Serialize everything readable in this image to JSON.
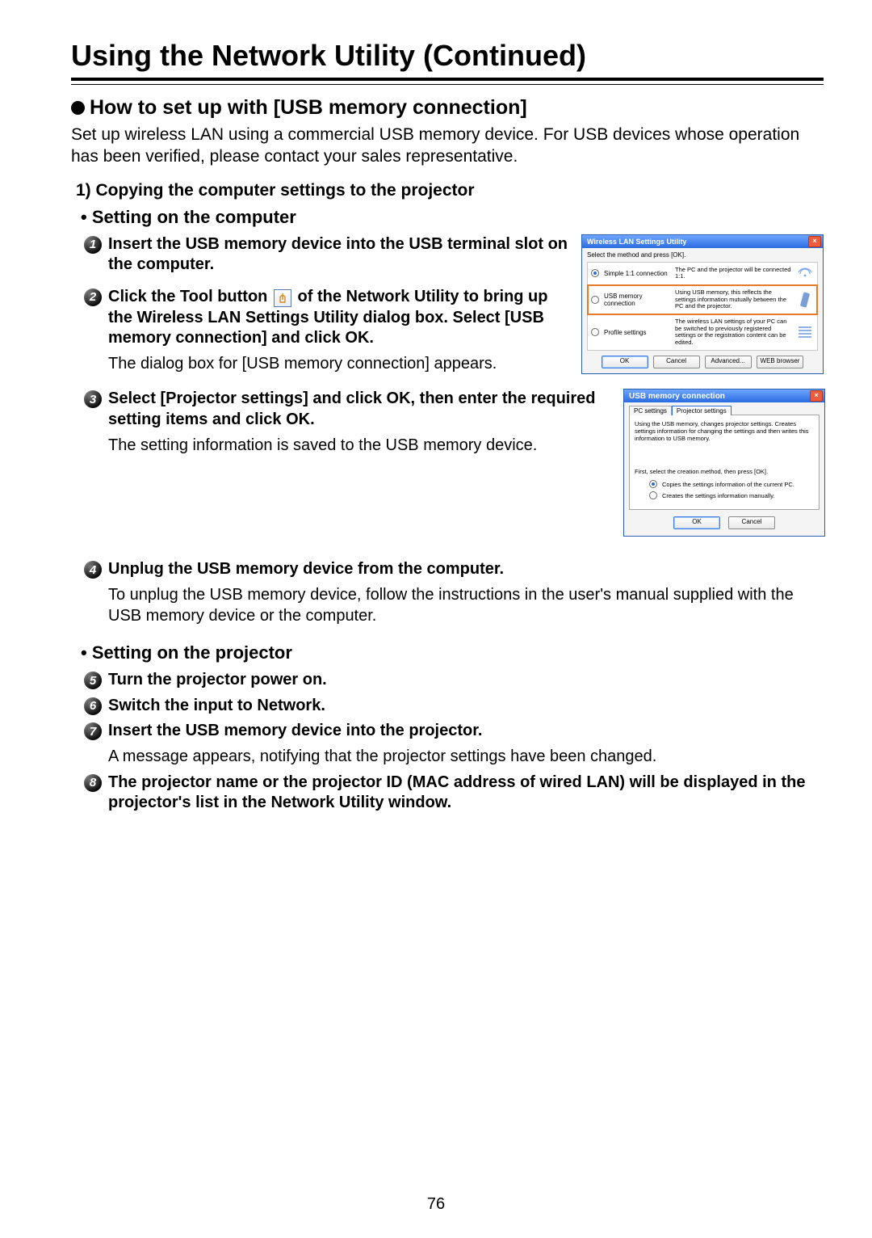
{
  "pageTitle": "Using the Network Utility (Continued)",
  "subheading": "How to set up with [USB memory connection]",
  "intro": "Set up wireless LAN using a commercial USB memory device. For USB devices whose operation has been verified, please contact your sales representative.",
  "section1Title": "1) Copying the computer settings to the projector",
  "subA": "• Setting on the computer",
  "subB": "• Setting on the projector",
  "stepsA": {
    "s1": {
      "num": "1",
      "title": "Insert the USB memory device into the USB terminal slot on the computer."
    },
    "s2": {
      "num": "2",
      "title_pre": "Click the Tool button ",
      "title_post": " of the Network Utility to bring up the Wireless LAN Settings Utility dialog box. Select [USB memory connection] and click OK.",
      "body": "The dialog box for [USB memory connection] appears."
    },
    "s3": {
      "num": "3",
      "title": "Select [Projector settings] and click OK, then enter the required setting items and click OK.",
      "body": "The setting information is saved to the USB memory device."
    },
    "s4": {
      "num": "4",
      "title": "Unplug the USB memory device from the computer.",
      "body": "To unplug the USB memory device, follow the instructions in the user's manual supplied with the USB memory device or the computer."
    }
  },
  "stepsB": {
    "s5": {
      "num": "5",
      "title": "Turn the projector power on."
    },
    "s6": {
      "num": "6",
      "title": "Switch the input to Network."
    },
    "s7": {
      "num": "7",
      "title": "Insert the USB memory device into the projector.",
      "body": "A message appears, notifying that the projector settings have been changed."
    },
    "s8": {
      "num": "8",
      "title": "The projector name or the projector ID (MAC address of wired LAN) will be displayed in the projector's list in the Network Utility window."
    }
  },
  "dlg1": {
    "title": "Wireless LAN Settings Utility",
    "prompt": "Select the method and press [OK].",
    "opts": [
      {
        "label": "Simple 1:1 connection",
        "desc": "The PC and the projector will be connected 1:1."
      },
      {
        "label": "USB memory connection",
        "desc": "Using USB memory, this reflects the settings information mutually between the PC and the projector."
      },
      {
        "label": "Profile settings",
        "desc": "The wireless LAN settings of your PC can be switched to previously registered settings or the registration content can be edited."
      }
    ],
    "btns": {
      "ok": "OK",
      "cancel": "Cancel",
      "advanced": "Advanced...",
      "web": "WEB browser"
    }
  },
  "dlg2": {
    "title": "USB memory connection",
    "tabs": {
      "pc": "PC settings",
      "proj": "Projector settings"
    },
    "desc": "Using the USB memory, changes projector settings. Creates settings information for changing the settings and then writes this information to USB memory.",
    "sub": "First, select the creation method, then press [OK].",
    "r1": "Copies the settings information of the current PC.",
    "r2": "Creates the settings information manually.",
    "btns": {
      "ok": "OK",
      "cancel": "Cancel"
    }
  },
  "pageNumber": "76"
}
